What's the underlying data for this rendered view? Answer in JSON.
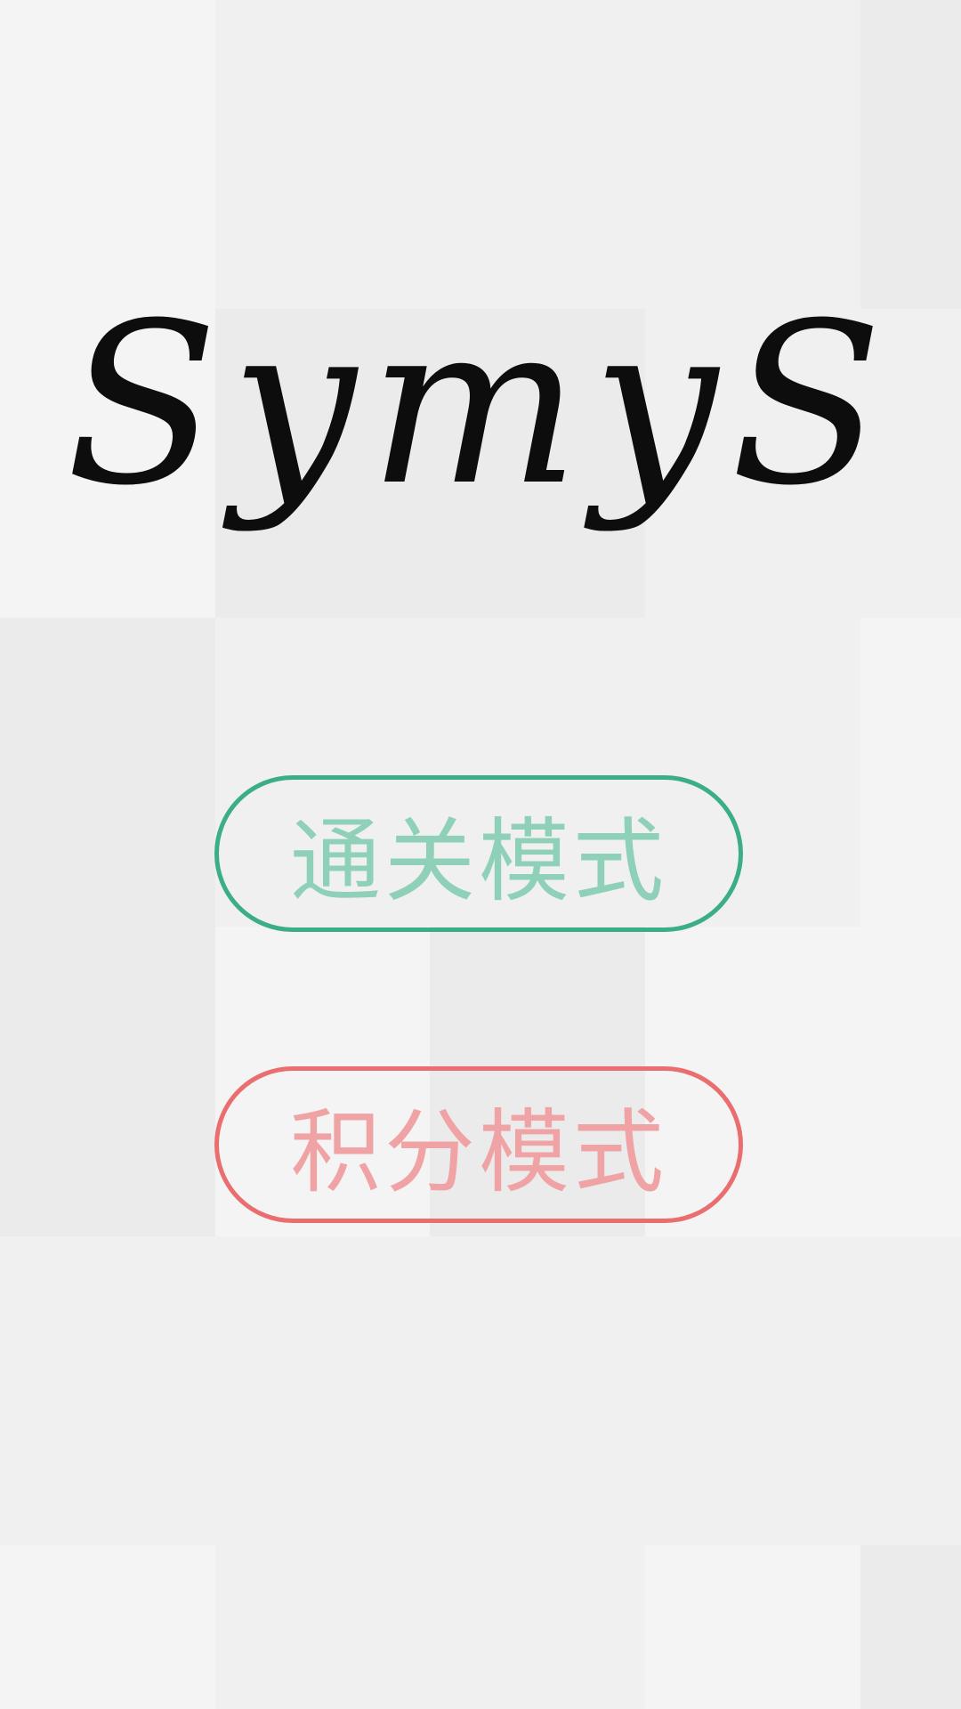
{
  "title": "SymyS",
  "buttons": {
    "level_mode": "通关模式",
    "score_mode": "积分模式"
  },
  "colors": {
    "background_light": "#f4f4f4",
    "background_mid": "#f0f0f0",
    "background_dark": "#ebebeb",
    "title": "#0d0d0d",
    "level_mode_border": "#3bae86",
    "level_mode_text": "#8ed0b8",
    "score_mode_border": "#ea6d70",
    "score_mode_text": "#f0a3a5"
  },
  "background_tiles": [
    [
      "light",
      "mid",
      "mid",
      "mid",
      "dark"
    ],
    [
      "light",
      "dark",
      "dark",
      "mid",
      "mid"
    ],
    [
      "dark",
      "mid",
      "mid",
      "mid",
      "light"
    ],
    [
      "dark",
      "light",
      "dark",
      "light",
      "light"
    ],
    [
      "mid",
      "mid",
      "mid",
      "mid",
      "mid"
    ],
    [
      "light",
      "mid",
      "mid",
      "light",
      "dark"
    ]
  ]
}
